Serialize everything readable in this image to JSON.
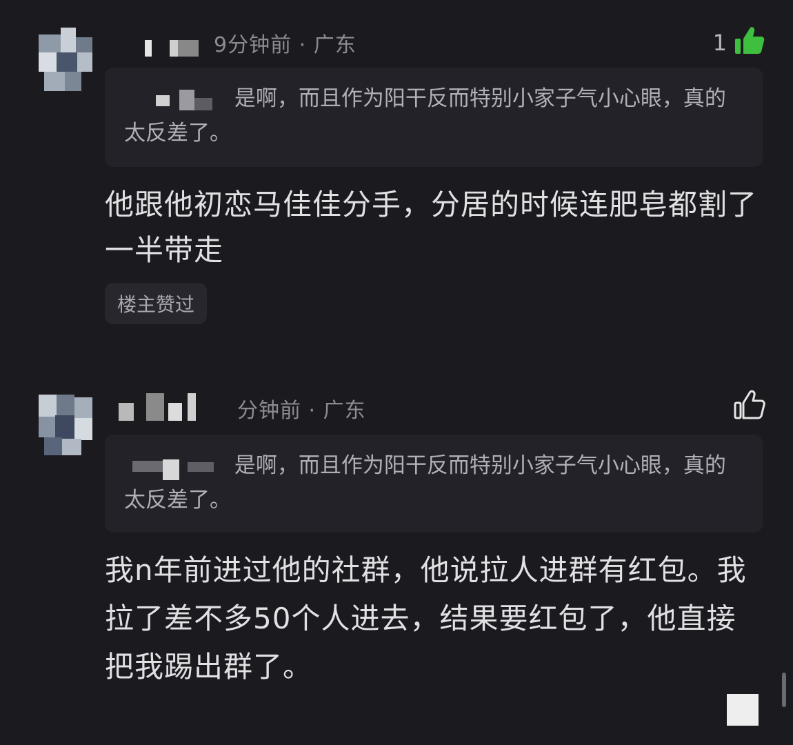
{
  "comments": [
    {
      "time_location": "9分钟前 · 广东",
      "like_count": "1",
      "like_icon": "thumb-up-filled-icon",
      "quote_text": "是啊，而且作为阳干反而特别小家子气小心眼，真的太反差了。",
      "body": "他跟他初恋马佳佳分手，分居的时候连肥皂都割了一半带走",
      "badge": "楼主赞过"
    },
    {
      "time_location": "分钟前 · 广东",
      "like_icon": "thumb-up-outline-icon",
      "quote_text": "是啊，而且作为阳干反而特别小家子气小心眼，真的太反差了。",
      "body": "我n年前进过他的社群，他说拉人进群有红包。我拉了差不多50个人进去，结果要红包了，他直接把我踢出群了。"
    }
  ],
  "colors": {
    "background": "#1b1a1f",
    "quote_bg": "#232228",
    "like_active": "#3fbf3f"
  }
}
